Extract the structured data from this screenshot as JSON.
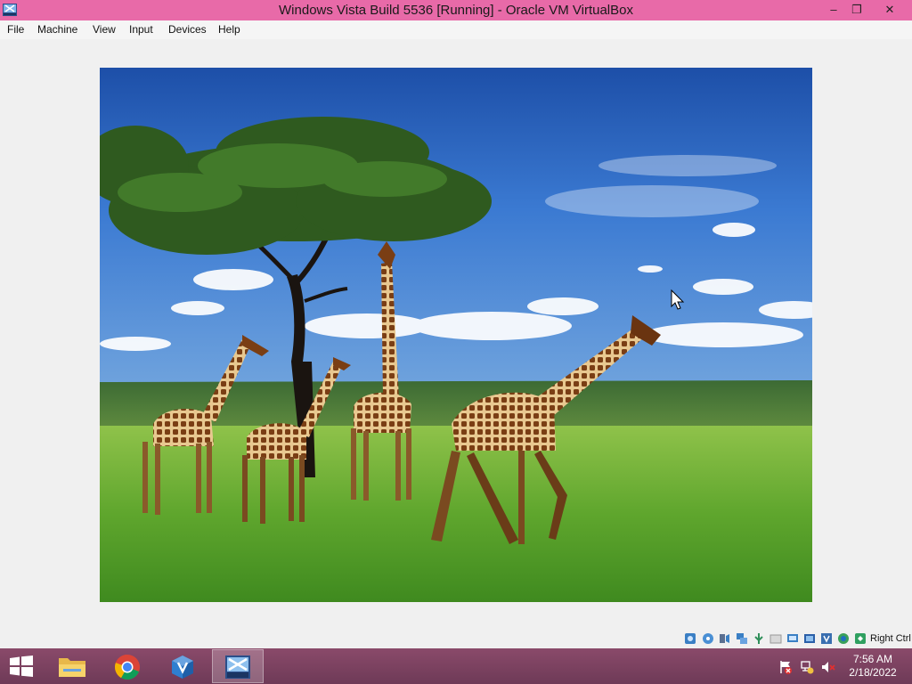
{
  "window": {
    "title": "Windows Vista Build 5536 [Running] - Oracle VM VirtualBox",
    "controls": {
      "minimize": "–",
      "restore": "❐",
      "close": "✕"
    }
  },
  "menu": [
    "File",
    "Machine",
    "View",
    "Input",
    "Devices",
    "Help"
  ],
  "guest": {
    "wallpaper": "giraffes-savanna"
  },
  "statusbar": {
    "icons": [
      "hard-disk-icon",
      "optical-drive-icon",
      "audio-icon",
      "network-icon",
      "usb-icon",
      "shared-folders-icon",
      "display-icon",
      "video-capture-icon",
      "cpu-icon",
      "mouse-integration-icon",
      "keyboard-icon"
    ],
    "host_key": "Right Ctrl"
  },
  "taskbar": {
    "apps": [
      "start-button",
      "file-explorer",
      "chrome",
      "virtualbox",
      "windows-vista-vm"
    ],
    "tray_icons": [
      "action-center-icon",
      "network-icon",
      "volume-muted-icon"
    ],
    "clock": {
      "time": "7:56 AM",
      "date": "2/18/2022"
    }
  }
}
